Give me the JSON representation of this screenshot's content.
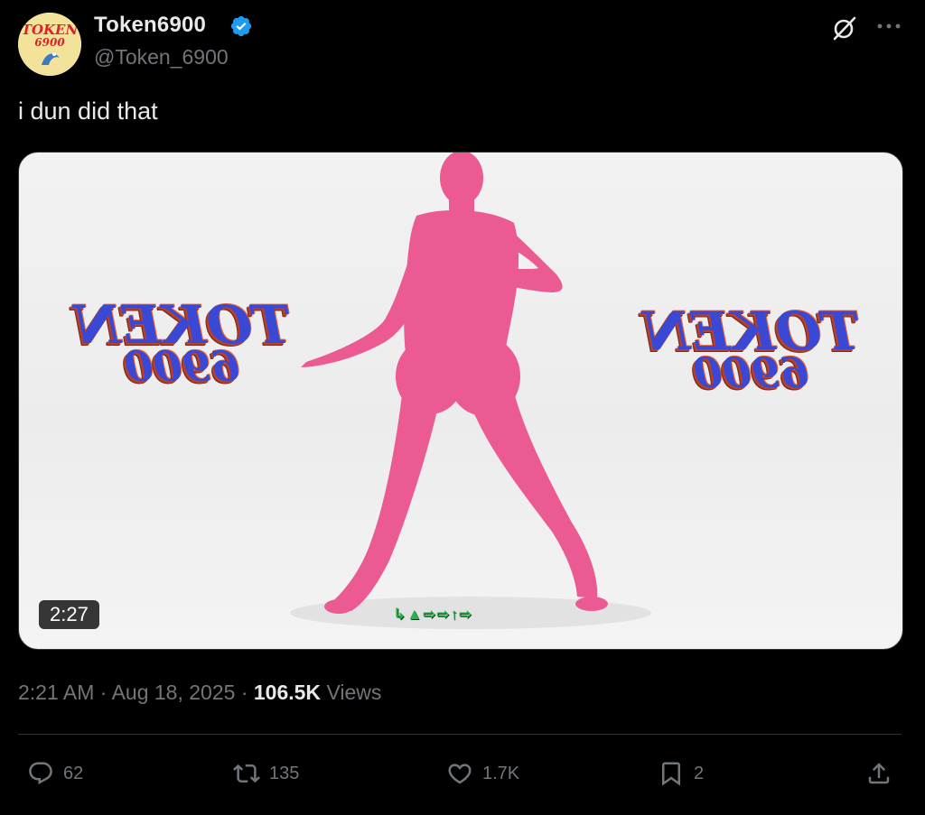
{
  "author": {
    "display_name": "Token6900",
    "handle": "@Token_6900",
    "avatar_text_top": "TOKEN",
    "avatar_text_bottom": "6900",
    "verified": true
  },
  "tweet": {
    "text": "i dun did that"
  },
  "media": {
    "duration": "2:27",
    "logo_line1": "TOKEN",
    "logo_line2": "6900",
    "caption_glyphs": "↳▲⇨⇨↑⇨"
  },
  "meta": {
    "time": "2:21 AM",
    "sep1": "·",
    "date": "Aug 18, 2025",
    "sep2": "·",
    "views_count": "106.5K",
    "views_label": "Views"
  },
  "actions": {
    "replies": "62",
    "reposts": "135",
    "likes": "1.7K",
    "bookmarks": "2"
  },
  "colors": {
    "background": "#000000",
    "text_primary": "#e7e9ea",
    "text_secondary": "#71767b",
    "verified_blue": "#1d9bf0",
    "body_pink": "#ec5a94",
    "logo_blue": "#3a48d6"
  },
  "icons": [
    "verified-badge-icon",
    "grok-icon",
    "more-icon",
    "reply-icon",
    "retweet-icon",
    "like-icon",
    "bookmark-icon",
    "share-icon"
  ]
}
